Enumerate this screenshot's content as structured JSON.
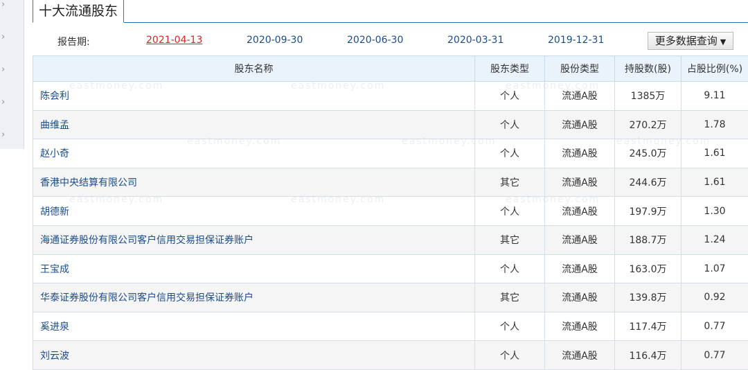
{
  "section": {
    "title": "十大流通股东"
  },
  "report_period": {
    "label": "报告期:",
    "dates": [
      "2021-04-13",
      "2020-09-30",
      "2020-06-30",
      "2020-03-31",
      "2019-12-31"
    ],
    "active_index": 0,
    "more_button": "更多数据查询"
  },
  "table": {
    "headers": [
      "股东名称",
      "股东类型",
      "股份类型",
      "持股数(股)",
      "占股比例(%)"
    ],
    "rows": [
      [
        "陈会利",
        "个人",
        "流通A股",
        "1385万",
        "9.11"
      ],
      [
        "曲维孟",
        "个人",
        "流通A股",
        "270.2万",
        "1.78"
      ],
      [
        "赵小奇",
        "个人",
        "流通A股",
        "245.0万",
        "1.61"
      ],
      [
        "香港中央结算有限公司",
        "其它",
        "流通A股",
        "244.6万",
        "1.61"
      ],
      [
        "胡德新",
        "个人",
        "流通A股",
        "197.9万",
        "1.30"
      ],
      [
        "海通证券股份有限公司客户信用交易担保证券账户",
        "其它",
        "流通A股",
        "188.7万",
        "1.24"
      ],
      [
        "王宝成",
        "个人",
        "流通A股",
        "163.0万",
        "1.07"
      ],
      [
        "华泰证券股份有限公司客户信用交易担保证券账户",
        "其它",
        "流通A股",
        "139.8万",
        "0.92"
      ],
      [
        "奚进泉",
        "个人",
        "流通A股",
        "117.4万",
        "0.77"
      ],
      [
        "刘云波",
        "个人",
        "流通A股",
        "116.4万",
        "0.77"
      ]
    ]
  },
  "watermark": "eastmoney.com",
  "colors": {
    "accent": "#1a6fb6",
    "active_date": "#d6242a",
    "header_bg": "#eaf3fc"
  }
}
